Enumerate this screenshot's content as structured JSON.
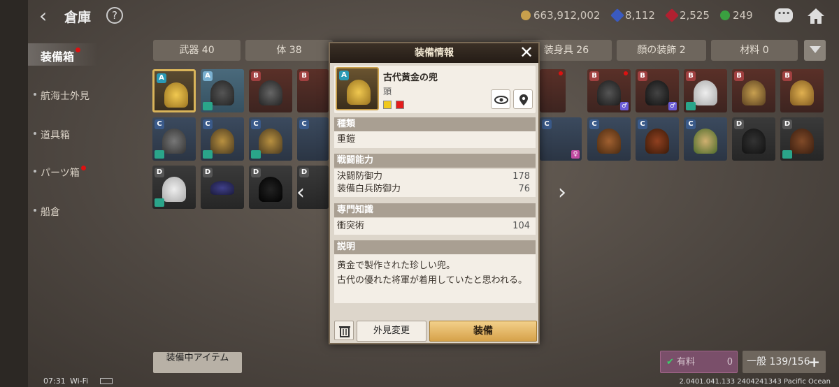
{
  "header": {
    "title": "倉庫",
    "currencies": [
      {
        "icon": "gold-coin-icon",
        "value": "663,912,002",
        "color": "#c9a04c"
      },
      {
        "icon": "blue-gem-icon",
        "value": "8,112",
        "color": "#3a5ac0"
      },
      {
        "icon": "red-gem-icon",
        "value": "2,525",
        "color": "#b02030"
      },
      {
        "icon": "green-gear-icon",
        "value": "249",
        "color": "#3aa040"
      }
    ]
  },
  "nav": [
    {
      "label": "装備箱",
      "active": true,
      "badge": true
    },
    {
      "label": "航海士外見"
    },
    {
      "label": "道具箱"
    },
    {
      "label": "パーツ箱",
      "badge": true
    },
    {
      "label": "船倉"
    }
  ],
  "tabs": [
    "武器 40",
    "体 38",
    "",
    "",
    "装身具 26",
    "顔の装飾 2",
    "材料 0"
  ],
  "grid": {
    "rows": [
      [
        "A",
        "A",
        "B",
        "B",
        "",
        "",
        "",
        "",
        "B",
        "B",
        "B",
        "B",
        "B",
        "B",
        "B"
      ],
      [
        "C",
        "C",
        "C",
        "C",
        "",
        "",
        "",
        "",
        "C",
        "C",
        "C",
        "C",
        "D",
        "D",
        "D"
      ],
      [
        "D",
        "D",
        "D",
        "D"
      ]
    ]
  },
  "modal": {
    "title": "装備情報",
    "item": {
      "name": "古代黄金の兜",
      "type": "頭",
      "colors": [
        "#f0c81c",
        "#e41c1c"
      ]
    },
    "sections": {
      "kind": {
        "title": "種類",
        "value": "重鎧"
      },
      "combat": {
        "title": "戦闘能力",
        "rows": [
          {
            "label": "決闘防御力",
            "value": "178"
          },
          {
            "label": "装備白兵防御力",
            "value": "76"
          }
        ]
      },
      "expertise": {
        "title": "専門知識",
        "rows": [
          {
            "label": "衝突術",
            "value": "104"
          }
        ]
      },
      "description": {
        "title": "説明",
        "line1": "黄金で製作された珍しい兜。",
        "line2": "古代の優れた将軍が着用していたと思われる。"
      }
    },
    "buttons": {
      "skin": "外見変更",
      "equip": "装備"
    }
  },
  "footer": {
    "equipped_items": "装備中アイテム",
    "paid_label": "有料",
    "paid_count": "0",
    "general": "一般 139/156"
  },
  "statusbar": {
    "time": "07:31",
    "wifi": "Wi-Fi"
  },
  "version": "2.0401.041.133 2404241343 Pacific Ocean"
}
